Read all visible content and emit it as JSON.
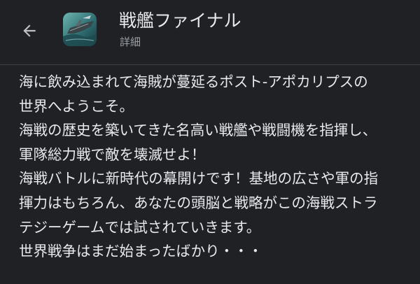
{
  "header": {
    "back_icon": "arrow-back-icon",
    "app_icon": "app-icon-battleship",
    "title": "戦艦ファイナル",
    "subtitle": "詳細"
  },
  "description": {
    "lines": [
      "海に飲み込まれて海賊が蔓延るポスト-アポカリプスの",
      "世界へようこそ。",
      "海戦の歴史を築いてきた名高い戦艦や戦闘機を指揮し、",
      "軍隊総力戦で敵を壊滅せよ！",
      "海戦バトルに新時代の幕開けです！基地の広さや軍の指",
      "揮力はもちろん、あなたの頭脳と戦略がこの海戦ストラ",
      "テジーゲームでは試されていきます。",
      "世界戦争はまだ始まったばかり・・・"
    ]
  }
}
